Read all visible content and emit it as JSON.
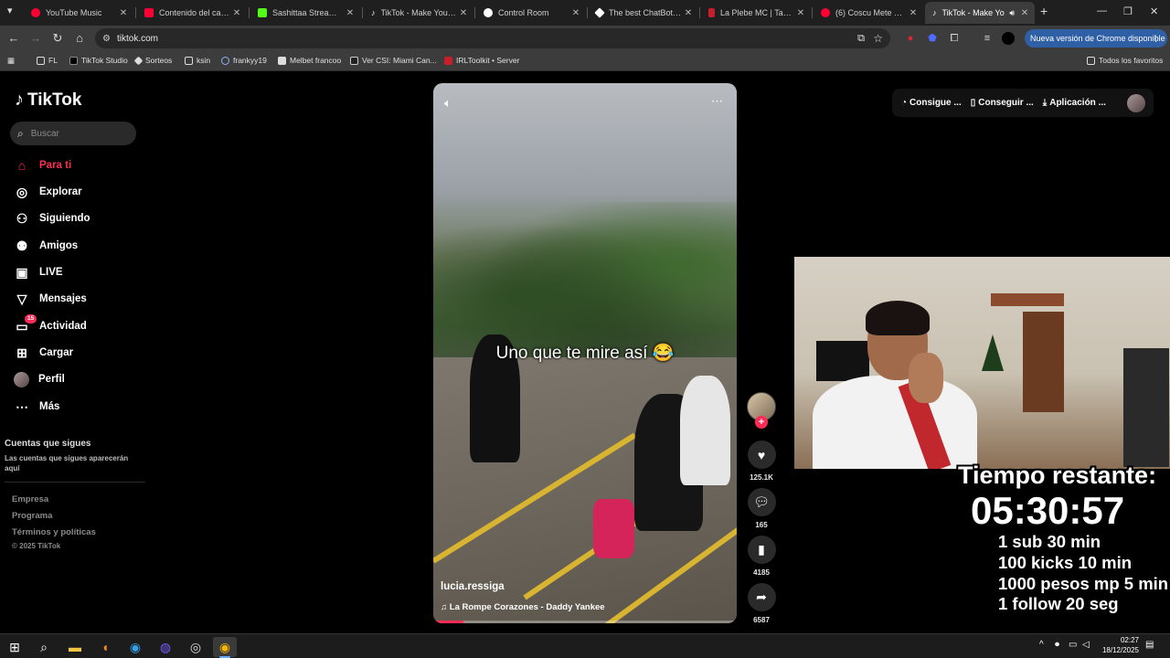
{
  "browser": {
    "tabs": [
      {
        "title": "YouTube Music",
        "color": "#ff0033",
        "active": false
      },
      {
        "title": "Contenido del canal",
        "color": "#ff0033",
        "active": false
      },
      {
        "title": "Sashittaa Stream - W",
        "color": "#53fc18",
        "active": false
      },
      {
        "title": "TikTok - Make Your D",
        "color": "#ffffff",
        "active": false
      },
      {
        "title": "Control Room",
        "color": "#ffffff",
        "active": false
      },
      {
        "title": "The best ChatBot and",
        "color": "#ffffff",
        "active": false
      },
      {
        "title": "La Plebe MC | Tablero",
        "color": "#c81e2b",
        "active": false
      },
      {
        "title": "(6) Coscu Mete Un Bi",
        "color": "#ff0033",
        "active": false
      },
      {
        "title": "TikTok - Make Yo",
        "color": "#ffffff",
        "active": true
      }
    ],
    "url": "tiktok.com",
    "update_label": "Nueva versión de Chrome disponible",
    "bookmarks": [
      {
        "label": "FL",
        "icon": "folder-icon"
      },
      {
        "label": "TikTok Studio",
        "icon": "tiktok-icon"
      },
      {
        "label": "Sorteos",
        "icon": "star-icon"
      },
      {
        "label": "ksin",
        "icon": "folder-icon"
      },
      {
        "label": "frankyy19",
        "icon": "link-icon"
      },
      {
        "label": "Melbet francoo",
        "icon": "page-icon"
      },
      {
        "label": "Ver CSI: Miami Can...",
        "icon": "tv-icon"
      },
      {
        "label": "IRLToolkit • Server",
        "icon": "server-icon"
      }
    ],
    "all_bookmarks": "Todos los favoritos"
  },
  "tiktok": {
    "logo": "TikTok",
    "search_placeholder": "Buscar",
    "nav": [
      {
        "label": "Para ti",
        "icon": "home-icon",
        "active": true
      },
      {
        "label": "Explorar",
        "icon": "compass-icon",
        "active": false
      },
      {
        "label": "Siguiendo",
        "icon": "following-icon",
        "active": false
      },
      {
        "label": "Amigos",
        "icon": "friends-icon",
        "active": false
      },
      {
        "label": "LIVE",
        "icon": "live-icon",
        "active": false
      },
      {
        "label": "Mensajes",
        "icon": "messages-icon",
        "active": false
      },
      {
        "label": "Actividad",
        "icon": "activity-icon",
        "active": false,
        "badge": "15"
      },
      {
        "label": "Cargar",
        "icon": "upload-icon",
        "active": false
      },
      {
        "label": "Perfil",
        "icon": "profile-icon",
        "active": false
      },
      {
        "label": "Más",
        "icon": "more-icon",
        "active": false
      }
    ],
    "following_title": "Cuentas que sigues",
    "following_desc": "Las cuentas que sigues aparecerán aquí",
    "footer": [
      "Empresa",
      "Programa",
      "Términos y políticas"
    ],
    "copyright": "© 2025 TikTok",
    "header": {
      "get_coins": "Consigue ...",
      "get_app": "Conseguir ...",
      "desktop_app": "Aplicación ..."
    },
    "video": {
      "caption": "Uno que te mire así 😂",
      "author": "lucia.ressiga",
      "music": "La Rompe Corazones - Daddy Yankee",
      "progress": 0.1,
      "likes": "125.1K",
      "comments": "165",
      "saves": "4185",
      "shares": "6587"
    }
  },
  "stream_overlay": {
    "title": "Tiempo restante:",
    "timer": "05:30:57",
    "rules": [
      "1 sub 30 min",
      "100 kicks 10 min",
      "1000 pesos mp 5 min",
      "1 follow 20 seg"
    ]
  },
  "taskbar": {
    "time": "02:27",
    "date": "18/12/2025"
  }
}
